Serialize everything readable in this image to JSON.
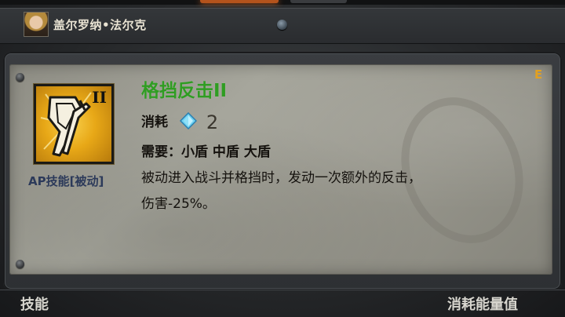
{
  "header": {
    "character_name": "盖尔罗纳•法尔克"
  },
  "skill": {
    "name": "格挡反击II",
    "tier": "II",
    "type_label": "AP技能[被动]",
    "grade": "E",
    "cost_label": "消耗",
    "cost_value": "2",
    "requirement_label": "需要：",
    "requirement_items": "小盾 中盾 大盾",
    "description_line1": "被动进入战斗并格挡时，发动一次额外的反击，",
    "description_line2": "伤害-25%。"
  },
  "footer": {
    "left_label": "技能",
    "right_label": "消耗能量值"
  },
  "icons": {
    "portrait": "character-portrait",
    "skill": "shield-counter-icon",
    "cost": "blue-diamond-icon"
  },
  "colors": {
    "skill_name": "#2f9d22",
    "grade": "#e2a021",
    "skill_type": "#2c3a5a",
    "icon_gold": "#e8a817"
  }
}
